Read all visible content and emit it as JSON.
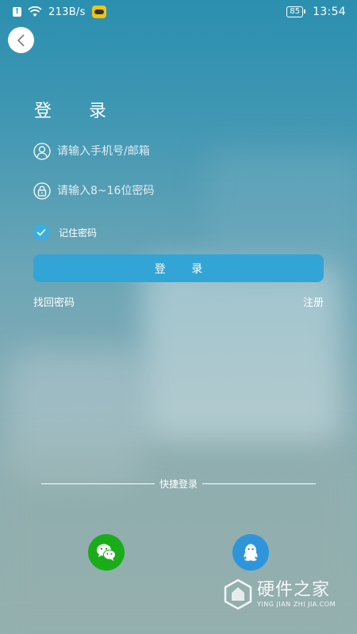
{
  "status_bar": {
    "net_speed": "213B/s",
    "battery": "85",
    "time": "13:54"
  },
  "title": "登 录",
  "form": {
    "account_placeholder": "请输入手机号/邮箱",
    "password_placeholder": "请输入8~16位密码",
    "remember_label": "记住密码",
    "remember_checked": true,
    "login_label": "登 录"
  },
  "links": {
    "forgot": "找回密码",
    "register": "注册"
  },
  "quick_login": {
    "label": "快捷登录",
    "providers": [
      "wechat",
      "qq"
    ]
  },
  "watermark": {
    "cn": "硬件之家",
    "en": "YING JIAN ZHI JIA.COM"
  },
  "colors": {
    "accent": "#33a4d6",
    "check": "#3aaee0",
    "wechat": "#1aad19",
    "qq": "#2e95db"
  }
}
